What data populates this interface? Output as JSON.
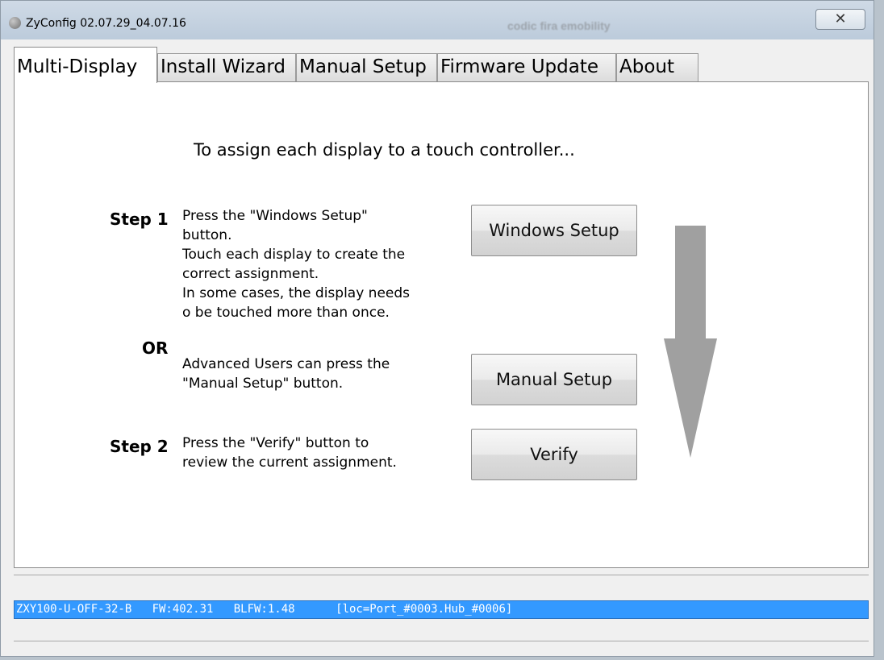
{
  "window": {
    "title": "ZyConfig 02.07.29_04.07.16",
    "background_title": "codic fira emobility",
    "close_glyph": "✕"
  },
  "tabs": [
    {
      "label": "Multi-Display",
      "active": true
    },
    {
      "label": "Install Wizard",
      "active": false
    },
    {
      "label": "Manual Setup",
      "active": false
    },
    {
      "label": "Firmware Update",
      "active": false
    },
    {
      "label": "About",
      "active": false
    }
  ],
  "main": {
    "headline": "To assign each display to a touch controller...",
    "step1": {
      "label": "Step 1",
      "text": "Press the \"Windows Setup\"\nbutton.\nTouch each display to create the\ncorrect assignment.\nIn some cases, the display needs\no be touched more than once."
    },
    "or_label": "OR",
    "advanced_text": "Advanced Users can press the\n\"Manual Setup\" button.",
    "step2": {
      "label": "Step 2",
      "text": "Press the \"Verify\" button to\nreview the current assignment."
    },
    "buttons": {
      "windows_setup": "Windows Setup",
      "manual_setup": "Manual Setup",
      "verify": "Verify"
    },
    "arrow_icon": "down-arrow-icon"
  },
  "status": {
    "device_line": "ZXY100-U-OFF-32-B   FW:402.31   BLFW:1.48      [loc=Port_#0003.Hub_#0006]"
  },
  "colors": {
    "status_bg": "#3399ff",
    "arrow": "#a0a0a0"
  }
}
